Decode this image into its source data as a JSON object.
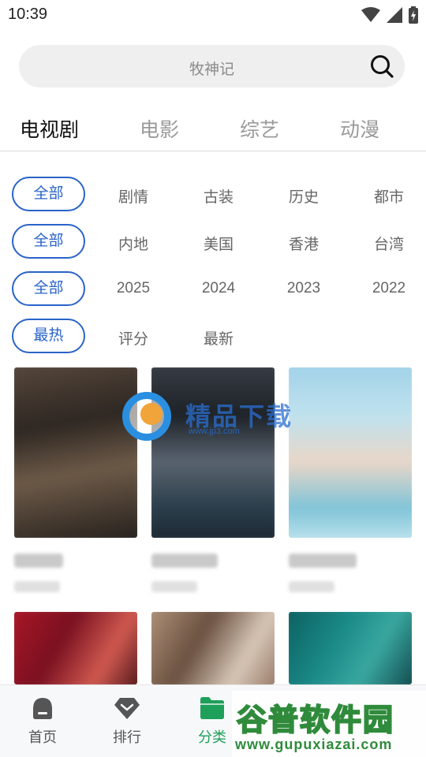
{
  "status_bar": {
    "time": "10:39"
  },
  "search": {
    "placeholder": "牧神记"
  },
  "category_tabs": [
    {
      "label": "电视剧",
      "active": true
    },
    {
      "label": "电影",
      "active": false
    },
    {
      "label": "综艺",
      "active": false
    },
    {
      "label": "动漫",
      "active": false
    }
  ],
  "filters": {
    "genre": {
      "selected": "全部",
      "options": [
        "剧情",
        "古装",
        "历史",
        "都市"
      ]
    },
    "region": {
      "selected": "全部",
      "options": [
        "内地",
        "美国",
        "香港",
        "台湾"
      ]
    },
    "year": {
      "selected": "全部",
      "options": [
        "2025",
        "2024",
        "2023",
        "2022"
      ]
    },
    "sort": {
      "selected": "最热",
      "options": [
        "评分",
        "最新"
      ]
    }
  },
  "watermark": {
    "center_text": "精品下载",
    "center_url": "www.jp3.com",
    "corner_text": "谷普软件园",
    "corner_url": "www.gupuxiazai.com"
  },
  "bottom_nav": [
    {
      "label": "首页",
      "icon": "home-icon",
      "active": false
    },
    {
      "label": "排行",
      "icon": "ranking-icon",
      "active": false
    },
    {
      "label": "分类",
      "icon": "folder-icon",
      "active": true
    }
  ],
  "colors": {
    "accent": "#2a63c9",
    "nav_active": "#1ea05a"
  }
}
